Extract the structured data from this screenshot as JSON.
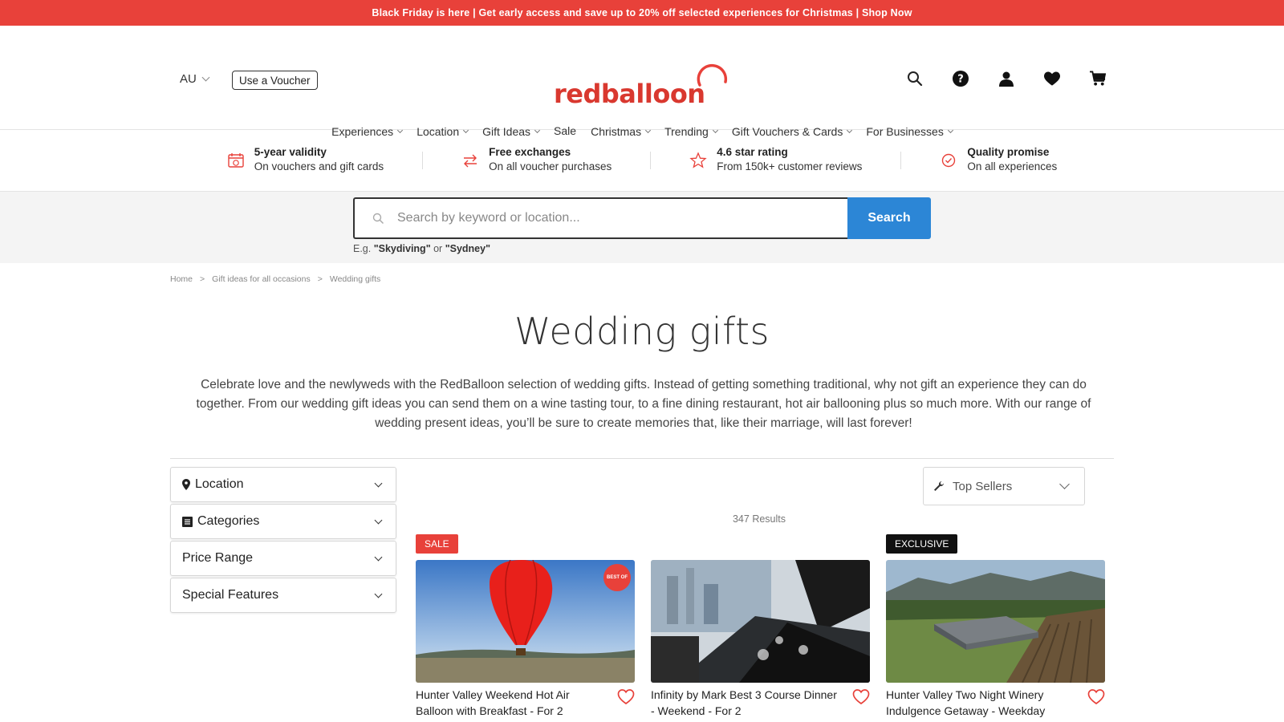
{
  "promo": {
    "text": "Black Friday is here | Get early access and save up to 20% off selected experiences for Christmas | Shop Now"
  },
  "header": {
    "country": "AU",
    "voucher_label": "Use a Voucher",
    "logo_text": "redballoon",
    "icons": [
      "search-icon",
      "help-icon",
      "account-icon",
      "wishlist-heart-icon",
      "cart-icon"
    ]
  },
  "nav": {
    "items": [
      {
        "label": "Experiences",
        "dropdown": true
      },
      {
        "label": "Location",
        "dropdown": true
      },
      {
        "label": "Gift Ideas",
        "dropdown": true
      },
      {
        "label": "Sale",
        "dropdown": false
      },
      {
        "label": "Christmas",
        "dropdown": true
      },
      {
        "label": "Trending",
        "dropdown": true
      },
      {
        "label": "Gift Vouchers & Cards",
        "dropdown": true
      },
      {
        "label": "For Businesses",
        "dropdown": true
      }
    ]
  },
  "usp": [
    {
      "title": "5-year validity",
      "subtitle": "On vouchers and gift cards",
      "icon": "calendar-icon"
    },
    {
      "title": "Free exchanges",
      "subtitle": "On all voucher purchases",
      "icon": "exchange-arrows-icon"
    },
    {
      "title": "4.6 star rating",
      "subtitle": "From 150k+ customer reviews",
      "icon": "star-icon"
    },
    {
      "title": "Quality promise",
      "subtitle": "On all experiences",
      "icon": "check-badge-icon"
    }
  ],
  "search": {
    "placeholder": "Search by keyword or location...",
    "button_label": "Search",
    "hint_prefix": "E.g. ",
    "hint_example1": "\"Skydiving\"",
    "hint_or": " or ",
    "hint_example2": "\"Sydney\""
  },
  "breadcrumb": {
    "items": [
      "Home",
      "Gift ideas for all occasions",
      "Wedding gifts"
    ],
    "separator": ">"
  },
  "page": {
    "title": "Wedding gifts",
    "intro": "Celebrate love and the newlyweds with the RedBalloon selection of wedding gifts. Instead of getting something traditional, why not gift an experience they can do together. From our wedding gift ideas you can send them on a wine tasting tour, to a fine dining restaurant, hot air ballooning plus so much more. With our range of wedding present ideas, you’ll be sure to create memories that, like their marriage, will last forever!"
  },
  "filters": [
    {
      "label": "Location",
      "icon": "map-pin-icon"
    },
    {
      "label": "Categories",
      "icon": "list-icon"
    },
    {
      "label": "Price Range",
      "icon": ""
    },
    {
      "label": "Special Features",
      "icon": ""
    }
  ],
  "sort": {
    "label": "Top Sellers",
    "icon": "wrench-icon"
  },
  "results": {
    "text": "347 Results"
  },
  "products": [
    {
      "badge": "SALE",
      "title": "Hunter Valley Weekend Hot Air Balloon with Breakfast - For 2",
      "best_of_label": "BEST OF"
    },
    {
      "badge": "",
      "title": "Infinity by Mark Best 3 Course Dinner - Weekend - For 2"
    },
    {
      "badge": "EXCLUSIVE",
      "title": "Hunter Valley Two Night Winery Indulgence Getaway - Weekday"
    }
  ],
  "colors": {
    "brand_red": "#e8413a",
    "search_blue": "#2c86d6",
    "text_dark": "#333333"
  }
}
